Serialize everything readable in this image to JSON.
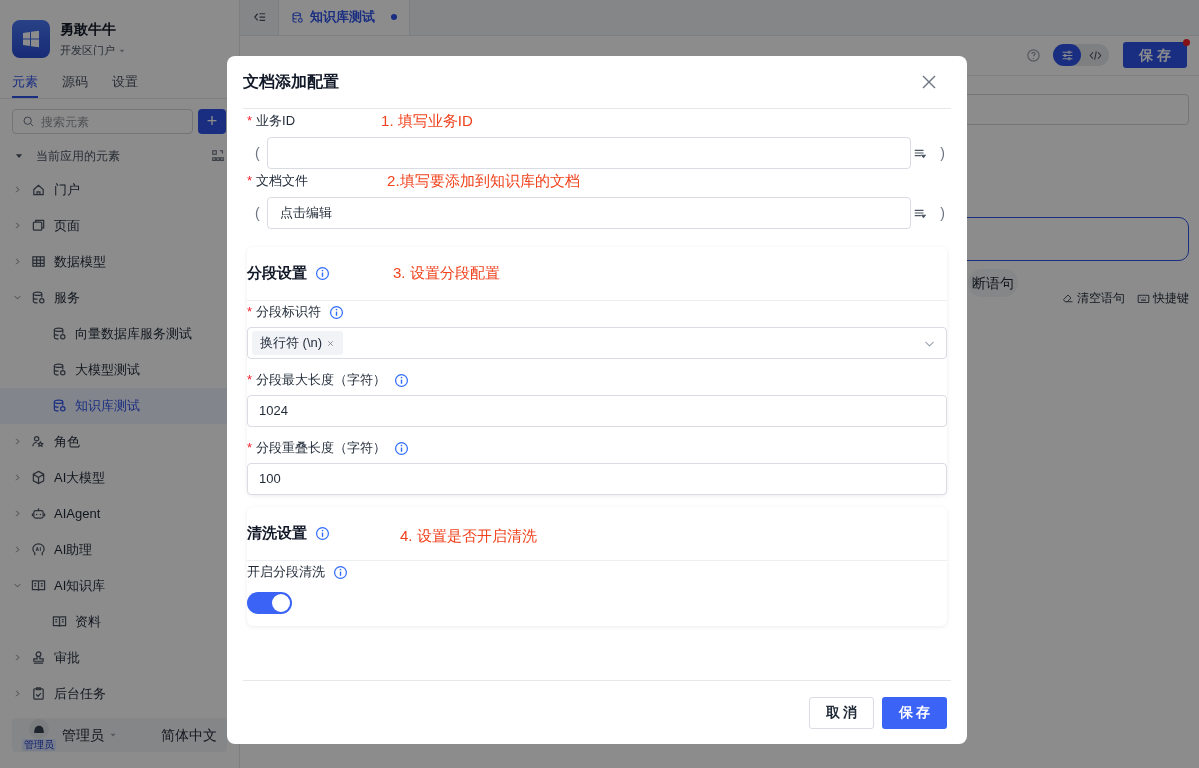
{
  "app": {
    "name": "勇敢牛牛",
    "portal": "开发区门户"
  },
  "sidebar": {
    "tabs": [
      {
        "label": "元素",
        "selected": true
      },
      {
        "label": "源码",
        "selected": false
      },
      {
        "label": "设置",
        "selected": false
      }
    ],
    "search": {
      "placeholder": "搜索元素"
    },
    "add_button": "+",
    "tree_title": "当前应用的元素",
    "tree": [
      {
        "label": "门户",
        "expanded": false,
        "selected": false
      },
      {
        "label": "页面",
        "expanded": false,
        "selected": false
      },
      {
        "label": "数据模型",
        "expanded": false,
        "selected": false
      },
      {
        "label": "服务",
        "expanded": true,
        "selected": false,
        "children": [
          {
            "label": "向量数据库服务测试",
            "selected": false
          },
          {
            "label": "大模型测试",
            "selected": false
          },
          {
            "label": "知识库测试",
            "selected": true
          }
        ]
      },
      {
        "label": "角色",
        "expanded": false,
        "selected": false
      },
      {
        "label": "AI大模型",
        "expanded": false,
        "selected": false
      },
      {
        "label": "AIAgent",
        "expanded": false,
        "selected": false
      },
      {
        "label": "AI助理",
        "expanded": false,
        "selected": false
      },
      {
        "label": "AI知识库",
        "expanded": true,
        "selected": false,
        "children": [
          {
            "label": "资料",
            "selected": false
          }
        ]
      },
      {
        "label": "审批",
        "expanded": false,
        "selected": false
      },
      {
        "label": "后台任务",
        "expanded": false,
        "selected": false
      }
    ],
    "user": {
      "avatar_label": "管理员",
      "name": "管理员",
      "language": "简体中文"
    }
  },
  "editor": {
    "tab": {
      "label": "知识库测试",
      "modified": true
    },
    "view_modes": [
      {
        "selected": true
      },
      {
        "selected": false
      }
    ],
    "save_button": "保 存",
    "save_badge": true,
    "interrupt_chip": "断语句",
    "clear_action": "清空语句",
    "shortcut_action": "快捷键"
  },
  "dialog": {
    "title": "文档添加配置",
    "required_mark": "*",
    "fields": [
      {
        "label": "业务ID",
        "required": true,
        "annotation": "1. 填写业务ID",
        "open_paren": "(",
        "close_paren": ")"
      },
      {
        "label": "文档文件",
        "required": true,
        "annotation": "2.填写要添加到知识库的文档",
        "value": "点击编辑",
        "open_paren": "(",
        "close_paren": ")"
      }
    ],
    "sections": [
      {
        "title": "分段设置",
        "annotation": "3. 设置分段配置",
        "items": [
          {
            "kind": "select",
            "label": "分段标识符",
            "required": true,
            "tags": [
              "换行符 (\\n)"
            ]
          },
          {
            "kind": "input",
            "label": "分段最大长度（字符）",
            "required": true,
            "value": "1024"
          },
          {
            "kind": "input",
            "label": "分段重叠长度（字符）",
            "required": true,
            "value": "100"
          }
        ]
      },
      {
        "title": "清洗设置",
        "annotation": "4. 设置是否开启清洗",
        "items": [
          {
            "kind": "switch",
            "label": "开启分段清洗",
            "required": false,
            "on": true
          }
        ]
      }
    ],
    "buttons": [
      {
        "label": "取 消",
        "primary": false
      },
      {
        "label": "保 存",
        "primary": true
      }
    ]
  }
}
